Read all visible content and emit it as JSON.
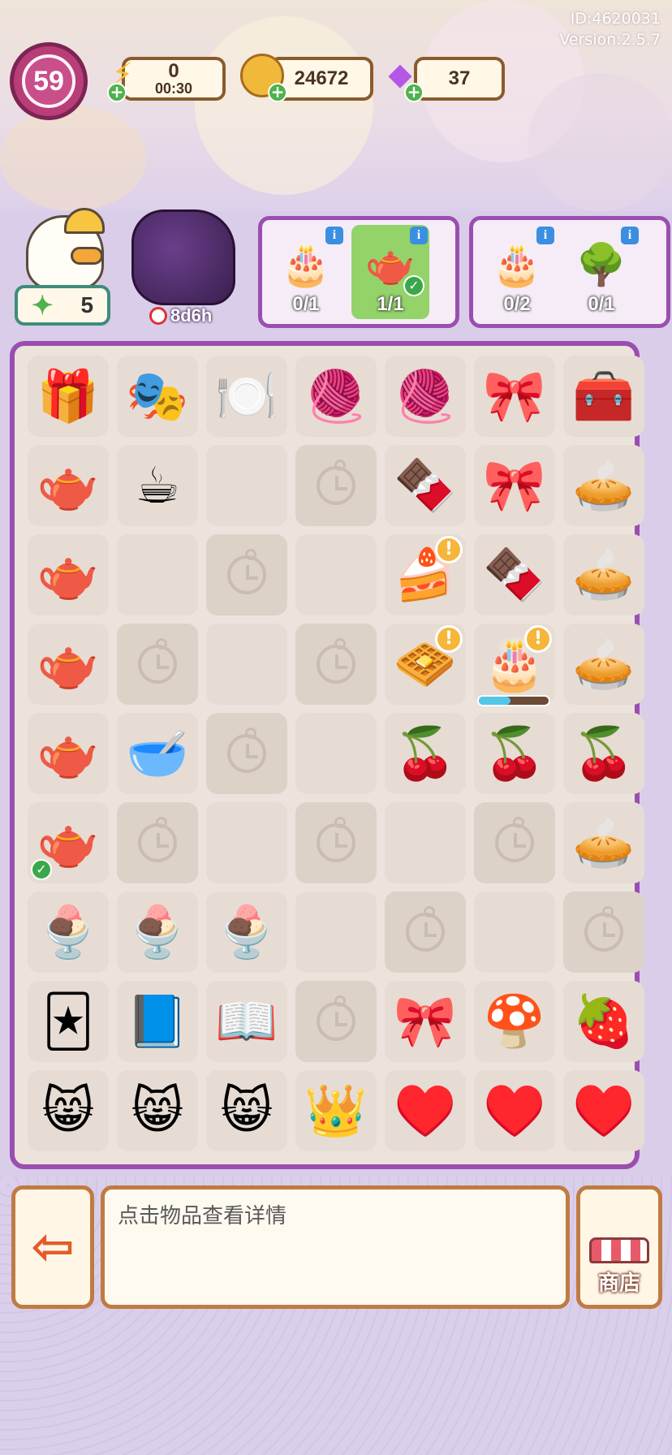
{
  "header": {
    "user_id": "ID:4620031",
    "version": "Version:2.5.7",
    "level": "59",
    "energy": {
      "value": "0",
      "timer": "00:30",
      "icon": "lightning-icon"
    },
    "coins": {
      "value": "24672",
      "icon": "coin-icon"
    },
    "gems": {
      "value": "37",
      "icon": "gem-icon"
    }
  },
  "orders": {
    "helper": {
      "stars": "5",
      "icon": "duck-helper-icon"
    },
    "producer": {
      "timer": "8d6h",
      "icon": "dark-tree-icon"
    },
    "order_groups": [
      {
        "items": [
          {
            "icon": "layer-cake-icon",
            "glyph": "🎂",
            "count": "0/1",
            "done": false
          },
          {
            "icon": "teapot-icon",
            "glyph": "🫖",
            "count": "1/1",
            "done": true
          }
        ]
      },
      {
        "items": [
          {
            "icon": "layer-cake-icon",
            "glyph": "🎂",
            "count": "0/2",
            "done": false
          },
          {
            "icon": "maze-icon",
            "glyph": "🌳",
            "count": "0/1",
            "done": false
          }
        ]
      }
    ]
  },
  "board": {
    "rows": [
      [
        {
          "type": "item",
          "icon": "energy-chest-icon",
          "glyph": "🎁"
        },
        {
          "type": "item",
          "icon": "cat-mask-icon",
          "glyph": "🎭"
        },
        {
          "type": "item",
          "icon": "tea-party-table-icon",
          "glyph": "🍽️"
        },
        {
          "type": "item",
          "icon": "yarn-spool-icon",
          "glyph": "🧶"
        },
        {
          "type": "item",
          "icon": "yarn-spool-icon",
          "glyph": "🧶"
        },
        {
          "type": "item",
          "icon": "fabric-rolls-icon",
          "glyph": "🎀"
        },
        {
          "type": "item",
          "icon": "energy-chest-icon",
          "glyph": "🧰"
        }
      ],
      [
        {
          "type": "item",
          "icon": "tea-table-icon",
          "glyph": "🫖"
        },
        {
          "type": "item",
          "icon": "teacup-icon",
          "glyph": "☕"
        },
        {
          "type": "empty"
        },
        {
          "type": "locked"
        },
        {
          "type": "item",
          "icon": "chocolate-bar-icon",
          "glyph": "🍫"
        },
        {
          "type": "item",
          "icon": "fabric-rolls-icon",
          "glyph": "🎀"
        },
        {
          "type": "item",
          "icon": "fruit-tart-icon",
          "glyph": "🥧"
        }
      ],
      [
        {
          "type": "item",
          "icon": "tea-table-icon",
          "glyph": "🫖"
        },
        {
          "type": "empty"
        },
        {
          "type": "locked"
        },
        {
          "type": "empty"
        },
        {
          "type": "item",
          "icon": "cheesecake-icon",
          "glyph": "🍰",
          "alert": true
        },
        {
          "type": "item",
          "icon": "chocolate-bar-icon",
          "glyph": "🍫"
        },
        {
          "type": "item",
          "icon": "fruit-tart-icon",
          "glyph": "🥧"
        }
      ],
      [
        {
          "type": "item",
          "icon": "tea-table-icon",
          "glyph": "🫖"
        },
        {
          "type": "locked"
        },
        {
          "type": "empty"
        },
        {
          "type": "locked"
        },
        {
          "type": "item",
          "icon": "waffle-icon",
          "glyph": "🧇",
          "alert": true
        },
        {
          "type": "item",
          "icon": "fruit-cake-icon",
          "glyph": "🎂",
          "alert": true,
          "progress": 0.45
        },
        {
          "type": "item",
          "icon": "fruit-tart-icon",
          "glyph": "🥧"
        }
      ],
      [
        {
          "type": "item",
          "icon": "tea-table-icon",
          "glyph": "🫖"
        },
        {
          "type": "item",
          "icon": "bowl-icon",
          "glyph": "🥣"
        },
        {
          "type": "locked"
        },
        {
          "type": "empty"
        },
        {
          "type": "item",
          "icon": "raspberry-icon",
          "glyph": "🍒"
        },
        {
          "type": "item",
          "icon": "raspberry-icon",
          "glyph": "🍒"
        },
        {
          "type": "item",
          "icon": "raspberry-icon",
          "glyph": "🍒"
        }
      ],
      [
        {
          "type": "item",
          "icon": "teapot-icon",
          "glyph": "🫖",
          "check": true
        },
        {
          "type": "locked"
        },
        {
          "type": "empty"
        },
        {
          "type": "locked"
        },
        {
          "type": "empty"
        },
        {
          "type": "locked"
        },
        {
          "type": "item",
          "icon": "fruit-tart-icon",
          "glyph": "🥧"
        }
      ],
      [
        {
          "type": "item",
          "icon": "berry-pudding-icon",
          "glyph": "🍨"
        },
        {
          "type": "item",
          "icon": "berry-pudding-icon",
          "glyph": "🍨"
        },
        {
          "type": "item",
          "icon": "berry-pudding-icon",
          "glyph": "🍨"
        },
        {
          "type": "empty"
        },
        {
          "type": "locked"
        },
        {
          "type": "empty"
        },
        {
          "type": "locked"
        }
      ],
      [
        {
          "type": "item",
          "icon": "card-soldiers-icon",
          "glyph": "🃏"
        },
        {
          "type": "item",
          "icon": "storybook-icon",
          "glyph": "📘"
        },
        {
          "type": "item",
          "icon": "open-book-icon",
          "glyph": "📖"
        },
        {
          "type": "locked"
        },
        {
          "type": "item",
          "icon": "ribbon-heart-icon",
          "glyph": "🎀"
        },
        {
          "type": "item",
          "icon": "caterpillar-mushroom-icon",
          "glyph": "🍄"
        },
        {
          "type": "item",
          "icon": "strawberry-icon",
          "glyph": "🍓"
        }
      ],
      [
        {
          "type": "item",
          "icon": "cheshire-cat-icon",
          "glyph": "😸"
        },
        {
          "type": "item",
          "icon": "cheshire-cat-icon",
          "glyph": "😸"
        },
        {
          "type": "item",
          "icon": "cheshire-cat-icon",
          "glyph": "😸"
        },
        {
          "type": "item",
          "icon": "queen-of-hearts-icon",
          "glyph": "👑"
        },
        {
          "type": "item",
          "icon": "heart-card-guard-icon",
          "glyph": "♥️"
        },
        {
          "type": "item",
          "icon": "heart-card-guard-icon",
          "glyph": "♥️"
        },
        {
          "type": "item",
          "icon": "heart-card-guard-icon",
          "glyph": "♥️"
        }
      ]
    ]
  },
  "footer": {
    "hint_text": "点击物品查看详情",
    "exit_icon": "exit-arrow-icon",
    "shop_label": "商店",
    "shop_icon": "shop-stall-icon"
  },
  "colors": {
    "board_border": "#9a4fb0",
    "frame_brown": "#c07b42",
    "level_badge": "#b83e78",
    "done_green": "#93d36a"
  }
}
